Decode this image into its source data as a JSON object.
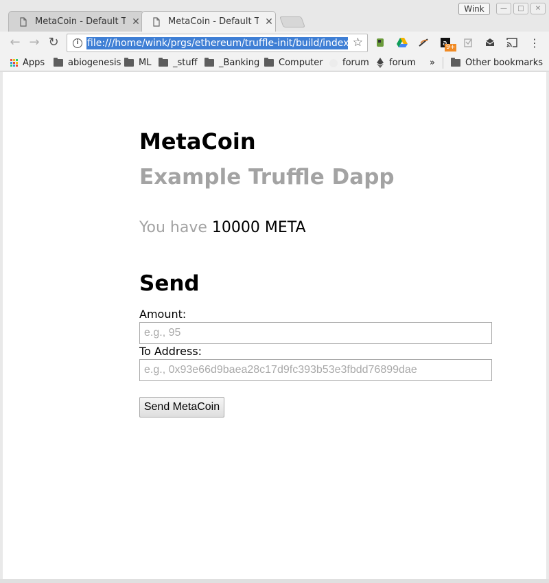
{
  "browser": {
    "tabs": [
      {
        "title": "MetaCoin - Default Tru",
        "active": false
      },
      {
        "title": "MetaCoin - Default Tru",
        "active": true
      }
    ],
    "window_label": "Wink",
    "url": "file:///home/wink/prgs/ethereum/truffle-init/build/index.html",
    "bookmarks": [
      {
        "label": "Apps",
        "icon": "apps-grid-icon"
      },
      {
        "label": "abiogenesis",
        "icon": "folder-icon"
      },
      {
        "label": "ML",
        "icon": "folder-icon"
      },
      {
        "label": "_stuff",
        "icon": "folder-icon"
      },
      {
        "label": "_Banking",
        "icon": "folder-icon"
      },
      {
        "label": "Computer",
        "icon": "folder-icon"
      },
      {
        "label": "forum",
        "icon": "globe-icon"
      },
      {
        "label": "forum",
        "icon": "ethereum-icon"
      }
    ],
    "overflow_chevron": "»",
    "other_bookmarks": "Other bookmarks",
    "extension_badge": "9+"
  },
  "page": {
    "title": "MetaCoin",
    "subtitle": "Example Truffle Dapp",
    "balance_prefix": "You have ",
    "balance_value": "10000",
    "balance_unit": "META",
    "send_heading": "Send",
    "amount_label": "Amount:",
    "amount_placeholder": "e.g., 95",
    "to_address_label": "To Address:",
    "to_address_placeholder": "e.g., 0x93e66d9baea28c17d9fc393b53e3fbdd76899dae",
    "send_button": "Send MetaCoin"
  },
  "colors": {
    "url_selection": "#3f7fd5",
    "muted_text": "#a3a3a3"
  }
}
